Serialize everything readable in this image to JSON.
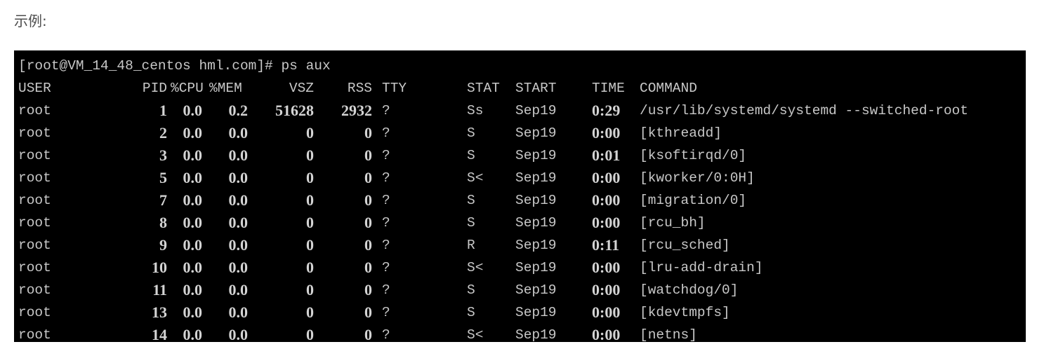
{
  "caption": "示例:",
  "terminal": {
    "prompt": "[root@VM_14_48_centos hml.com]# ps aux",
    "headers": {
      "user": "USER",
      "pid": "PID",
      "cpu": "%CPU",
      "mem": "%MEM",
      "vsz": "VSZ",
      "rss": "RSS",
      "tty": "TTY",
      "stat": "STAT",
      "start": "START",
      "time": "TIME",
      "command": "COMMAND"
    },
    "rows": [
      {
        "user": "root",
        "pid": "1",
        "cpu": "0.0",
        "mem": "0.2",
        "vsz": "51628",
        "rss": "2932",
        "tty": "?",
        "stat": "Ss",
        "start": "Sep19",
        "time": "0:29",
        "command": "/usr/lib/systemd/systemd --switched-root"
      },
      {
        "user": "root",
        "pid": "2",
        "cpu": "0.0",
        "mem": "0.0",
        "vsz": "0",
        "rss": "0",
        "tty": "?",
        "stat": "S",
        "start": "Sep19",
        "time": "0:00",
        "command": "[kthreadd]"
      },
      {
        "user": "root",
        "pid": "3",
        "cpu": "0.0",
        "mem": "0.0",
        "vsz": "0",
        "rss": "0",
        "tty": "?",
        "stat": "S",
        "start": "Sep19",
        "time": "0:01",
        "command": "[ksoftirqd/0]"
      },
      {
        "user": "root",
        "pid": "5",
        "cpu": "0.0",
        "mem": "0.0",
        "vsz": "0",
        "rss": "0",
        "tty": "?",
        "stat": "S<",
        "start": "Sep19",
        "time": "0:00",
        "command": "[kworker/0:0H]"
      },
      {
        "user": "root",
        "pid": "7",
        "cpu": "0.0",
        "mem": "0.0",
        "vsz": "0",
        "rss": "0",
        "tty": "?",
        "stat": "S",
        "start": "Sep19",
        "time": "0:00",
        "command": "[migration/0]"
      },
      {
        "user": "root",
        "pid": "8",
        "cpu": "0.0",
        "mem": "0.0",
        "vsz": "0",
        "rss": "0",
        "tty": "?",
        "stat": "S",
        "start": "Sep19",
        "time": "0:00",
        "command": "[rcu_bh]"
      },
      {
        "user": "root",
        "pid": "9",
        "cpu": "0.0",
        "mem": "0.0",
        "vsz": "0",
        "rss": "0",
        "tty": "?",
        "stat": "R",
        "start": "Sep19",
        "time": "0:11",
        "command": "[rcu_sched]"
      },
      {
        "user": "root",
        "pid": "10",
        "cpu": "0.0",
        "mem": "0.0",
        "vsz": "0",
        "rss": "0",
        "tty": "?",
        "stat": "S<",
        "start": "Sep19",
        "time": "0:00",
        "command": "[lru-add-drain]"
      },
      {
        "user": "root",
        "pid": "11",
        "cpu": "0.0",
        "mem": "0.0",
        "vsz": "0",
        "rss": "0",
        "tty": "?",
        "stat": "S",
        "start": "Sep19",
        "time": "0:00",
        "command": "[watchdog/0]"
      },
      {
        "user": "root",
        "pid": "13",
        "cpu": "0.0",
        "mem": "0.0",
        "vsz": "0",
        "rss": "0",
        "tty": "?",
        "stat": "S",
        "start": "Sep19",
        "time": "0:00",
        "command": "[kdevtmpfs]"
      },
      {
        "user": "root",
        "pid": "14",
        "cpu": "0.0",
        "mem": "0.0",
        "vsz": "0",
        "rss": "0",
        "tty": "?",
        "stat": "S<",
        "start": "Sep19",
        "time": "0:00",
        "command": "[netns]"
      }
    ]
  }
}
